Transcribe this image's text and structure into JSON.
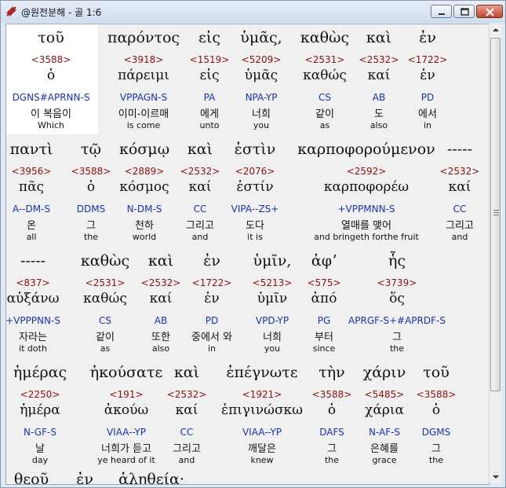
{
  "window": {
    "title": "@원전분해 - 골 1:6",
    "icon": "app-logo-icon",
    "buttons": [
      "minimize-icon",
      "maximize-icon",
      "close-icon"
    ]
  },
  "lines": [
    {
      "words": [
        {
          "g1": "τοῦ",
          "num": "<3588>",
          "g2": "ὁ",
          "par": "DGNS#APRNN-S",
          "kor": "이 복음이",
          "eng": "Which"
        },
        {
          "g1": "παρόντος",
          "num": "<3918>",
          "g2": "πάρειμι",
          "par": "VPPAGN-S",
          "kor": "이미-이르매",
          "eng": "is come"
        },
        {
          "g1": "εἰς",
          "num": "<1519>",
          "g2": "εἰς",
          "par": "PA",
          "kor": "에게",
          "eng": "unto"
        },
        {
          "g1": "ὑμᾶς,",
          "num": "<5209>",
          "g2": "ὑμᾶς",
          "par": "NPA-YP",
          "kor": "너희",
          "eng": "you"
        },
        {
          "g1": "καθὼς",
          "num": "<2531>",
          "g2": "καθώς",
          "par": "CS",
          "kor": "같이",
          "eng": "as"
        },
        {
          "g1": "καὶ",
          "num": "<2532>",
          "g2": "καί",
          "par": "AB",
          "kor": "도",
          "eng": "also"
        },
        {
          "g1": "ἐν",
          "num": "<1722>",
          "g2": "ἐν",
          "par": "PD",
          "kor": "에서",
          "eng": "in"
        }
      ]
    },
    {
      "words": [
        {
          "g1": "παντὶ",
          "num": "<3956>",
          "g2": "πᾶς",
          "par": "A--DM-S",
          "kor": "온",
          "eng": "all"
        },
        {
          "g1": "τῷ",
          "num": "<3588>",
          "g2": "ὁ",
          "par": "DDMS",
          "kor": "그",
          "eng": "the"
        },
        {
          "g1": "κόσμῳ",
          "num": "<2889>",
          "g2": "κόσμος",
          "par": "N-DM-S",
          "kor": "천하",
          "eng": "world"
        },
        {
          "g1": "καὶ",
          "num": "<2532>",
          "g2": "καί",
          "par": "CC",
          "kor": "그리고",
          "eng": "and"
        },
        {
          "g1": "ἐστὶν",
          "num": "<2076>",
          "g2": "ἐστίν",
          "par": "VIPA--ZS+",
          "kor": "도다",
          "eng": "it is"
        },
        {
          "g1": "καρποφορούμενον",
          "num": "<2592>",
          "g2": "καρποφορέω",
          "par": "+VPPMNN-S",
          "kor": "열매를 맺어",
          "eng": "and bringeth forthe fruit"
        },
        {
          "g1": "-----",
          "num": "<2532>",
          "g2": "καί",
          "par": "CC",
          "kor": "그리고",
          "eng": "and"
        }
      ]
    },
    {
      "words": [
        {
          "g1": "-----",
          "num": "<837>",
          "g2": "αὐξάνω",
          "par": "+VPPPNN-S",
          "kor": "자라는",
          "eng": "it doth"
        },
        {
          "g1": "καθὼς",
          "num": "<2531>",
          "g2": "καθώς",
          "par": "CS",
          "kor": "같이",
          "eng": "as"
        },
        {
          "g1": "καὶ",
          "num": "<2532>",
          "g2": "καί",
          "par": "AB",
          "kor": "또한",
          "eng": "also"
        },
        {
          "g1": "ἐν",
          "num": "<1722>",
          "g2": "ἐν",
          "par": "PD",
          "kor": "중에서 와",
          "eng": "in"
        },
        {
          "g1": "ὑμῖν,",
          "num": "<5213>",
          "g2": "ὑμῖν",
          "par": "VPD-YP",
          "kor": "너희",
          "eng": "you"
        },
        {
          "g1": "ἀφʼ",
          "num": "<575>",
          "g2": "ἀπό",
          "par": "PG",
          "kor": "부터",
          "eng": "since"
        },
        {
          "g1": "ἧς",
          "num": "<3739>",
          "g2": "ὅς",
          "par": "APRGF-S+#APRDF-S",
          "kor": "그",
          "eng": "the"
        }
      ]
    },
    {
      "words": [
        {
          "g1": "ἡμέρας",
          "num": "<2250>",
          "g2": "ἡμέρα",
          "par": "N-GF-S",
          "kor": "날",
          "eng": "day"
        },
        {
          "g1": "ἠκούσατε",
          "num": "<191>",
          "g2": "ἀκούω",
          "par": "VIAA--YP",
          "kor": "너희가 듣고",
          "eng": "ye heard of it"
        },
        {
          "g1": "καὶ",
          "num": "<2532>",
          "g2": "καί",
          "par": "CC",
          "kor": "그리고",
          "eng": "and"
        },
        {
          "g1": "ἐπέγνωτε",
          "num": "<1921>",
          "g2": "ἐπιγινώσκω",
          "par": "VIAA--YP",
          "kor": "깨달은",
          "eng": "knew"
        },
        {
          "g1": "τὴν",
          "num": "<3588>",
          "g2": "ὁ",
          "par": "DAFS",
          "kor": "그",
          "eng": "the"
        },
        {
          "g1": "χάριν",
          "num": "<5485>",
          "g2": "χάρια",
          "par": "N-AF-S",
          "kor": "은혜를",
          "eng": "grace"
        },
        {
          "g1": "τοῦ",
          "num": "<3588>",
          "g2": "ὁ",
          "par": "DGMS",
          "kor": "그",
          "eng": "the"
        }
      ]
    },
    {
      "words": [
        {
          "g1": "θεοῦ"
        },
        {
          "g1": "ἐν"
        },
        {
          "g1": "ἀληθείᾳ·"
        }
      ]
    }
  ]
}
